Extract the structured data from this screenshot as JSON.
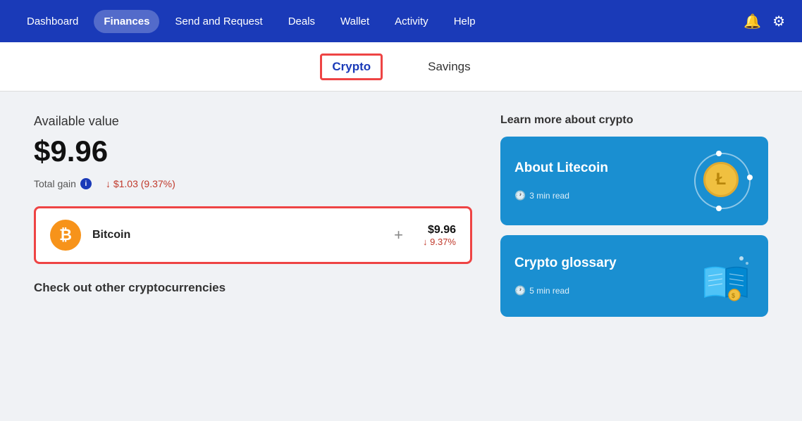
{
  "navbar": {
    "items": [
      {
        "id": "dashboard",
        "label": "Dashboard",
        "active": false
      },
      {
        "id": "finances",
        "label": "Finances",
        "active": true
      },
      {
        "id": "send-request",
        "label": "Send and Request",
        "active": false
      },
      {
        "id": "deals",
        "label": "Deals",
        "active": false
      },
      {
        "id": "wallet",
        "label": "Wallet",
        "active": false
      },
      {
        "id": "activity",
        "label": "Activity",
        "active": false
      },
      {
        "id": "help",
        "label": "Help",
        "active": false
      }
    ],
    "notification_icon": "🔔",
    "settings_icon": "⚙"
  },
  "subtabs": [
    {
      "id": "crypto",
      "label": "Crypto",
      "active": true
    },
    {
      "id": "savings",
      "label": "Savings",
      "active": false
    }
  ],
  "main": {
    "available_value_label": "Available value",
    "available_value": "$9.96",
    "total_gain_label": "Total gain",
    "total_gain_value": "↓ $1.03 (9.37%)",
    "crypto_card": {
      "name": "Bitcoin",
      "usd_value": "$9.96",
      "percent_change": "↓ 9.37%",
      "icon_letter": "₿"
    },
    "check_out_label": "Check out other cryptocurrencies"
  },
  "right_panel": {
    "learn_label": "Learn more about crypto",
    "cards": [
      {
        "id": "about-litecoin",
        "title": "About Litecoin",
        "read_time": "3 min read"
      },
      {
        "id": "crypto-glossary",
        "title": "Crypto glossary",
        "read_time": "5 min read"
      }
    ]
  }
}
